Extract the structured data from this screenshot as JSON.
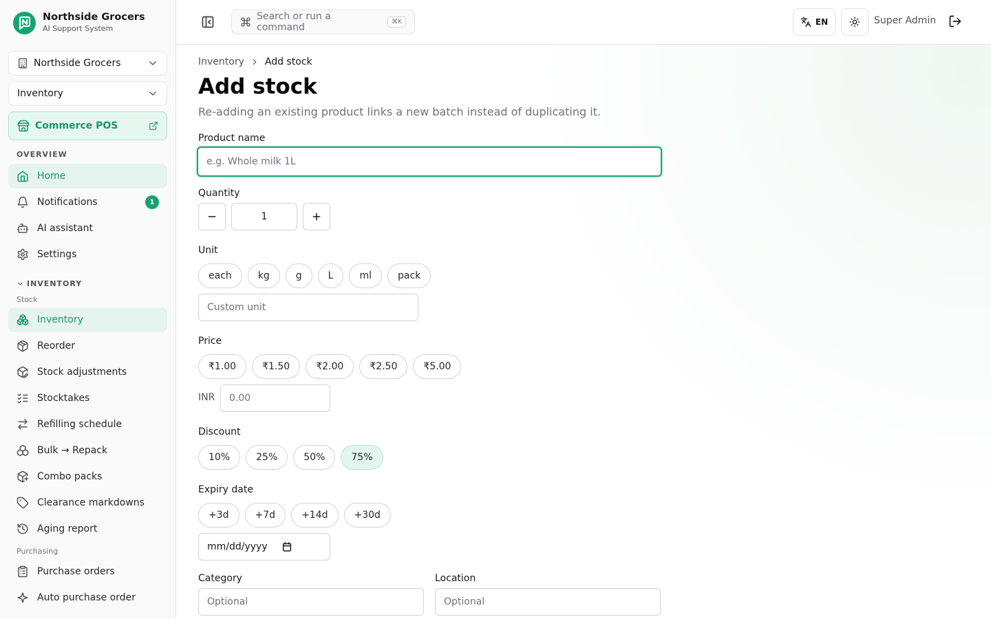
{
  "brand": {
    "name": "Northside Grocers",
    "subtitle": "AI Support System"
  },
  "sidebar": {
    "store_select": "Northside Grocers",
    "module_select": "Inventory",
    "pos_button": "Commerce POS",
    "overview_title": "OVERVIEW",
    "overview_items": [
      {
        "label": "Home",
        "icon": "home-icon",
        "active": true
      },
      {
        "label": "Notifications",
        "icon": "bell-icon",
        "badge": "1"
      },
      {
        "label": "AI assistant",
        "icon": "bot-icon"
      },
      {
        "label": "Settings",
        "icon": "gear-icon"
      }
    ],
    "inventory_title": "INVENTORY",
    "stock_group": "Stock",
    "stock_items": [
      {
        "label": "Inventory",
        "icon": "boxes-icon",
        "active": true
      },
      {
        "label": "Reorder",
        "icon": "package-icon"
      },
      {
        "label": "Stock adjustments",
        "icon": "package-edit-icon"
      },
      {
        "label": "Stocktakes",
        "icon": "list-check-icon"
      },
      {
        "label": "Refilling schedule",
        "icon": "arrows-swap-icon"
      },
      {
        "label": "Bulk → Repack",
        "icon": "boxes-icon"
      },
      {
        "label": "Combo packs",
        "icon": "package-plus-icon"
      },
      {
        "label": "Clearance markdowns",
        "icon": "tag-icon"
      },
      {
        "label": "Aging report",
        "icon": "history-icon"
      }
    ],
    "purchasing_group": "Purchasing",
    "purchasing_items": [
      {
        "label": "Purchase orders",
        "icon": "clipboard-icon"
      },
      {
        "label": "Auto purchase order",
        "icon": "sparkles-icon"
      }
    ]
  },
  "header": {
    "search_placeholder": "Search or run a command",
    "search_shortcut": "⌘K",
    "language": "EN",
    "user": "Super Admin"
  },
  "breadcrumb": {
    "parent": "Inventory",
    "current": "Add stock"
  },
  "page": {
    "title": "Add stock",
    "description": "Re-adding an existing product links a new batch instead of duplicating it."
  },
  "form": {
    "product_name": {
      "label": "Product name",
      "placeholder": "e.g. Whole milk 1L",
      "value": ""
    },
    "quantity": {
      "label": "Quantity",
      "value": "1"
    },
    "unit": {
      "label": "Unit",
      "options": [
        "each",
        "kg",
        "g",
        "L",
        "ml",
        "pack"
      ],
      "custom_placeholder": "Custom unit"
    },
    "price": {
      "label": "Price",
      "options": [
        "₹1.00",
        "₹1.50",
        "₹2.00",
        "₹2.50",
        "₹5.00"
      ],
      "currency": "INR",
      "placeholder": "0.00"
    },
    "discount": {
      "label": "Discount",
      "options": [
        "10%",
        "25%",
        "50%",
        "75%"
      ],
      "selected": "75%"
    },
    "expiry": {
      "label": "Expiry date",
      "options": [
        "+3d",
        "+7d",
        "+14d",
        "+30d"
      ],
      "date_placeholder": "mm/dd/yyyy"
    },
    "category": {
      "label": "Category",
      "placeholder": "Optional"
    },
    "location": {
      "label": "Location",
      "placeholder": "Optional"
    }
  },
  "colors": {
    "accent": "#16a373",
    "accent_soft": "#e6f4ee"
  }
}
